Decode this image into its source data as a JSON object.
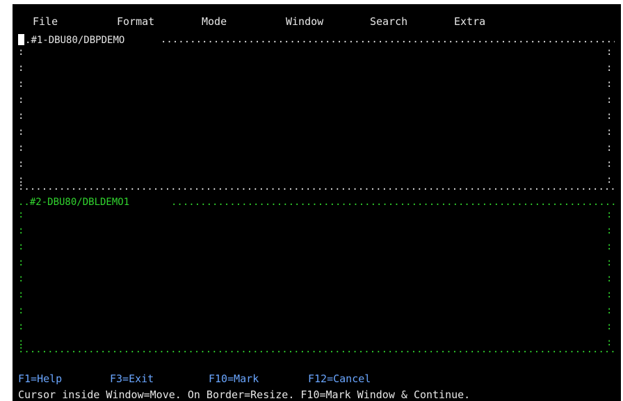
{
  "menu": {
    "items": [
      {
        "label": "File"
      },
      {
        "label": "Format"
      },
      {
        "label": "Mode"
      },
      {
        "label": "Window"
      },
      {
        "label": "Search"
      },
      {
        "label": "Extra"
      }
    ]
  },
  "window1": {
    "title": "#1-DBU80/DBPDEMO"
  },
  "window2": {
    "title": "#2-DBU80/DBLDEMO1"
  },
  "function_keys": [
    {
      "label": "F1=Help"
    },
    {
      "label": "F3=Exit"
    },
    {
      "label": "F10=Mark"
    },
    {
      "label": "F12=Cancel"
    }
  ],
  "status": {
    "text": "Cursor inside Window=Move.  On Border=Resize.  F10=Mark Window & Continue."
  },
  "colors": {
    "background": "#000000",
    "window1_border": "#e6e6e6",
    "window2_border": "#31d42e",
    "function_keys": "#6aa6ff",
    "text": "#e8e8e8"
  }
}
